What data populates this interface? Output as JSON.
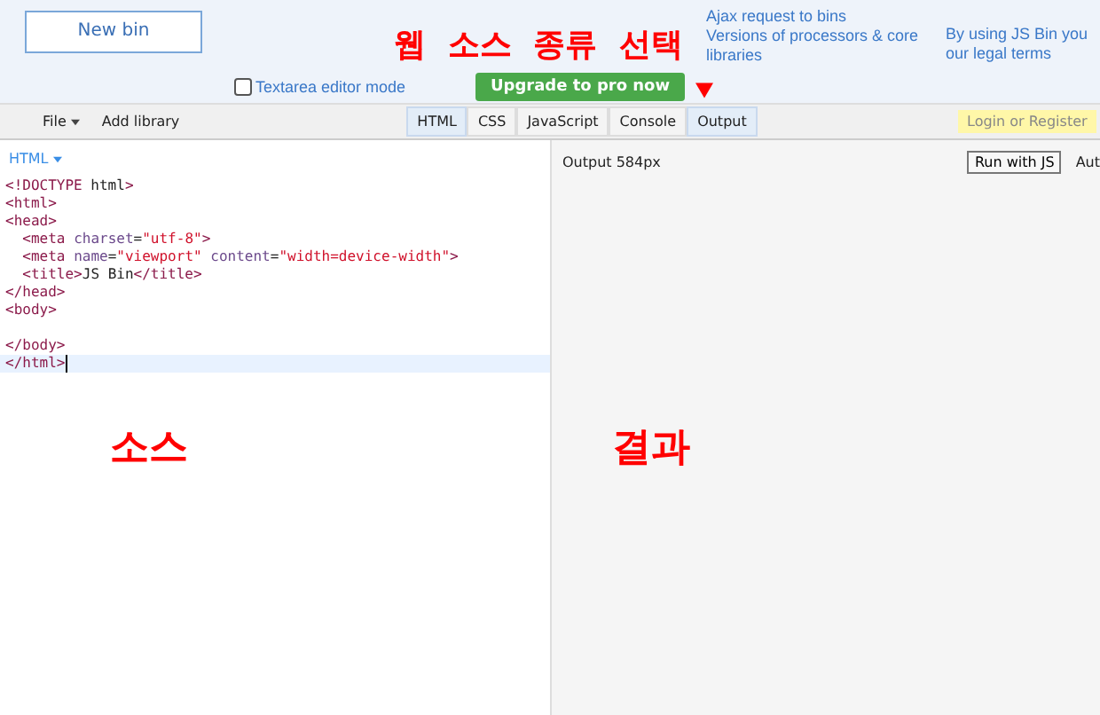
{
  "menu_panel": {
    "new_bin": "New bin",
    "columns": [
      {
        "links": [
          "Ajax request to bins",
          "Versions of processors & core",
          "libraries"
        ]
      },
      {
        "links": [
          "By using JS Bin you",
          "our legal terms"
        ]
      }
    ],
    "textarea_mode": {
      "label": "Textarea editor mode",
      "checked": false
    },
    "upgrade": "Upgrade to pro now"
  },
  "annotation": {
    "title": "웹 소스 종류 선택",
    "source": "소스",
    "result": "결과"
  },
  "toolbar": {
    "file": "File",
    "add_library": "Add library",
    "tabs": [
      {
        "label": "HTML",
        "selected": true
      },
      {
        "label": "CSS",
        "selected": false
      },
      {
        "label": "JavaScript",
        "selected": false
      },
      {
        "label": "Console",
        "selected": false
      },
      {
        "label": "Output",
        "selected": true
      }
    ],
    "login": "Login or Register"
  },
  "editor": {
    "language": "HTML",
    "lines": [
      {
        "text": "<!DOCTYPE html>",
        "active": false
      },
      {
        "text": "<html>",
        "active": false
      },
      {
        "text": "<head>",
        "active": false
      },
      {
        "text": "  <meta charset=\"utf-8\">",
        "active": false
      },
      {
        "text": "  <meta name=\"viewport\" content=\"width=device-width\">",
        "active": false
      },
      {
        "text": "  <title>JS Bin</title>",
        "active": false
      },
      {
        "text": "</head>",
        "active": false
      },
      {
        "text": "<body>",
        "active": false
      },
      {
        "active": false
      },
      {
        "text": "</body>",
        "active": false
      },
      {
        "text": "</html>",
        "active": true
      }
    ]
  },
  "output": {
    "size": "Output 584px",
    "run": "Run with JS",
    "auto": "Aut"
  }
}
